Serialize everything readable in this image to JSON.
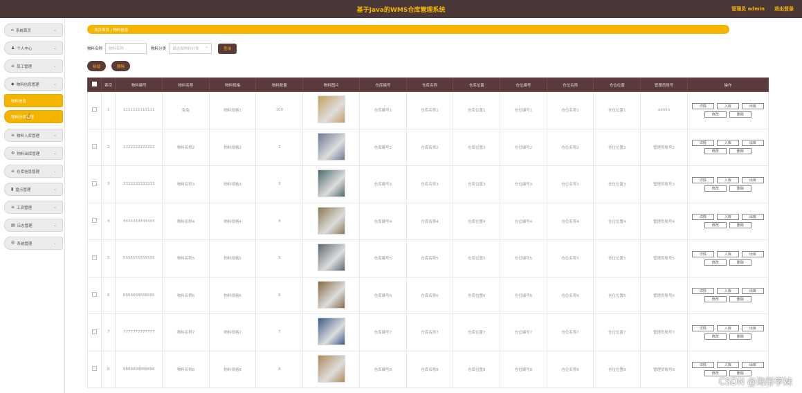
{
  "app": {
    "title": "基于Java的WMS仓库管理系统",
    "user": "管理员 admin",
    "logout": "退出登录"
  },
  "sidebar": {
    "items": [
      {
        "label": "系统首页",
        "icon": "home-icon",
        "glyph": "⌂"
      },
      {
        "label": "个人中心",
        "icon": "user-icon",
        "glyph": "♟"
      },
      {
        "label": "员工管理",
        "icon": "list-icon",
        "glyph": "≡"
      },
      {
        "label": "物料信息管理",
        "icon": "box-icon",
        "glyph": "◆"
      },
      {
        "label": "物料信息",
        "icon": "",
        "glyph": ""
      },
      {
        "label": "物料分类管理",
        "icon": "",
        "glyph": ""
      },
      {
        "label": "物料入库管理",
        "icon": "list-icon",
        "glyph": "≡"
      },
      {
        "label": "物料出库管理",
        "icon": "gear-icon",
        "glyph": "⚙"
      },
      {
        "label": "仓库信息管理",
        "icon": "list-icon",
        "glyph": "≡"
      },
      {
        "label": "盘点管理",
        "icon": "chart-icon",
        "glyph": "▮"
      },
      {
        "label": "工资管理",
        "icon": "list-icon",
        "glyph": "≡"
      },
      {
        "label": "日志管理",
        "icon": "doc-icon",
        "glyph": "▤"
      },
      {
        "label": "系统管理",
        "icon": "settings-icon",
        "glyph": "☰"
      }
    ]
  },
  "breadcrumb": "首页首页 / 物料信息",
  "search": {
    "label1": "物料名称",
    "placeholder1": "物料名称",
    "label2": "物料分类",
    "placeholder2": "请选择物料分类",
    "button": "查询"
  },
  "actions": {
    "add": "新增",
    "delete": "删除"
  },
  "table": {
    "headers": [
      "",
      "索引",
      "物料编号",
      "物料名称",
      "物料规格",
      "物料数量",
      "物料图片",
      "仓库编号",
      "仓库名称",
      "仓库位置",
      "仓位编号",
      "仓位名称",
      "仓位位置",
      "管理员账号",
      "操作"
    ],
    "rows": [
      {
        "idx": "1",
        "code": "1111111111111",
        "name": "兔兔",
        "spec": "物料规格1",
        "qty": "100",
        "color": "#c8a060",
        "wc": "仓库编号1",
        "wn": "仓库名称1",
        "wp": "仓库位置1",
        "pc": "仓位编号1",
        "pn": "仓位名称1",
        "pp": "仓位位置1",
        "admin": "admin"
      },
      {
        "idx": "2",
        "code": "2222222222222",
        "name": "物料名称2",
        "spec": "物料规格2",
        "qty": "2",
        "color": "#6b7b94",
        "wc": "仓库编号2",
        "wn": "仓库名称2",
        "wp": "仓库位置2",
        "pc": "仓位编号2",
        "pn": "仓位名称2",
        "pp": "仓位位置2",
        "admin": "管理员账号2"
      },
      {
        "idx": "3",
        "code": "3333333333333",
        "name": "物料名称3",
        "spec": "物料规格3",
        "qty": "3",
        "color": "#4f6a6e",
        "wc": "仓库编号3",
        "wn": "仓库名称3",
        "wp": "仓库位置3",
        "pc": "仓位编号3",
        "pn": "仓位名称3",
        "pp": "仓位位置3",
        "admin": "管理员账号3"
      },
      {
        "idx": "4",
        "code": "4444444444444",
        "name": "物料名称4",
        "spec": "物料规格4",
        "qty": "4",
        "color": "#8a7a50",
        "wc": "仓库编号4",
        "wn": "仓库名称4",
        "wp": "仓库位置4",
        "pc": "仓位编号4",
        "pn": "仓位名称4",
        "pp": "仓位位置4",
        "admin": "管理员账号4"
      },
      {
        "idx": "5",
        "code": "5555555555555",
        "name": "物料名称5",
        "spec": "物料规格5",
        "qty": "5",
        "color": "#5e6870",
        "wc": "仓库编号5",
        "wn": "仓库名称5",
        "wp": "仓库位置5",
        "pc": "仓位编号5",
        "pn": "仓位名称5",
        "pp": "仓位位置5",
        "admin": "管理员账号5"
      },
      {
        "idx": "6",
        "code": "6666666666666",
        "name": "物料名称6",
        "spec": "物料规格6",
        "qty": "6",
        "color": "#8a6a44",
        "wc": "仓库编号6",
        "wn": "仓库名称6",
        "wp": "仓库位置6",
        "pc": "仓位编号6",
        "pn": "仓位名称6",
        "pp": "仓位位置6",
        "admin": "管理员账号6"
      },
      {
        "idx": "7",
        "code": "7777777777777",
        "name": "物料名称7",
        "spec": "物料规格7",
        "qty": "7",
        "color": "#3d5c8a",
        "wc": "仓库编号7",
        "wn": "仓库名称7",
        "wp": "仓库位置7",
        "pc": "仓位编号7",
        "pn": "仓位名称7",
        "pp": "仓位位置7",
        "admin": "管理员账号7"
      },
      {
        "idx": "8",
        "code": "8888888888888",
        "name": "物料名称8",
        "spec": "物料规格8",
        "qty": "8",
        "color": "#b08a58",
        "wc": "仓库编号8",
        "wn": "仓库名称8",
        "wp": "仓库位置8",
        "pc": "仓位编号8",
        "pn": "仓位名称8",
        "pp": "仓位位置8",
        "admin": "管理员账号8"
      }
    ],
    "ops": [
      "详情",
      "入库",
      "出库",
      "修改",
      "删除"
    ]
  },
  "watermark": "CSDN @海彤学妹",
  "colors": {
    "topbar": "#4a3738",
    "accent": "#f5b400",
    "header": "#5a3a3a"
  }
}
